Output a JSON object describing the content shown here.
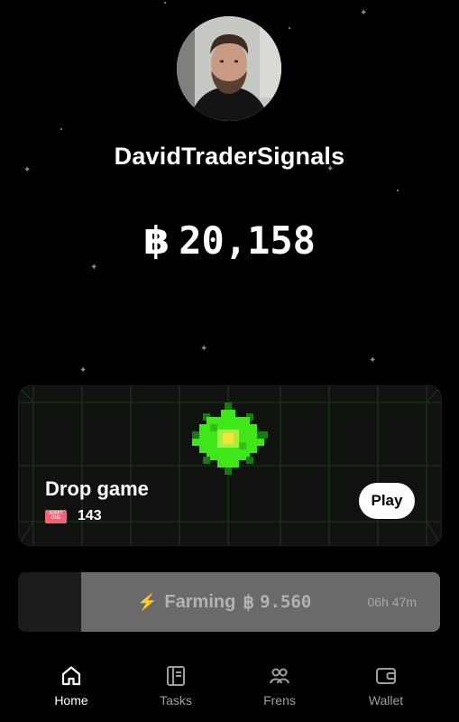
{
  "profile": {
    "username": "DavidTraderSignals"
  },
  "balance": {
    "symbol": "฿",
    "amount": "20,158"
  },
  "game_card": {
    "title": "Drop game",
    "ticket_count": "143",
    "ticket_icon_text": "ADMIT ONE",
    "play_label": "Play"
  },
  "farming": {
    "label": "Farming",
    "symbol": "฿",
    "amount": "9.560",
    "time_left": "06h 47m",
    "progress_percent": 15
  },
  "nav": {
    "items": [
      {
        "label": "Home",
        "icon": "home-icon",
        "active": true
      },
      {
        "label": "Tasks",
        "icon": "tasks-icon",
        "active": false
      },
      {
        "label": "Frens",
        "icon": "frens-icon",
        "active": false
      },
      {
        "label": "Wallet",
        "icon": "wallet-icon",
        "active": false
      }
    ]
  },
  "colors": {
    "background": "#000000",
    "accent_green": "#3ee61a",
    "ticket": "#f06277",
    "bolt": "#e8b84a"
  }
}
